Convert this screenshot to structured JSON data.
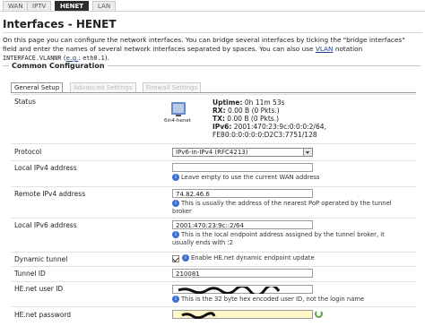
{
  "topTabs": [
    "WAN",
    "IPTV",
    "HENET",
    "LAN"
  ],
  "activeTopTab": "HENET",
  "title": "Interfaces - HENET",
  "intro": {
    "line1": "On this page you can configure the network interfaces. You can bridge several interfaces by ticking the \"bridge interfaces\"",
    "line2": "field and enter the names of several network interfaces separated by spaces. You can also use",
    "vlan": "VLAN",
    "line2b": "notation",
    "line3_code": "INTERFACE.VLANNR",
    "line3_eg": "e.g.",
    "line3_example": "eth0.1"
  },
  "legend": "Common Configuration",
  "subTabs": [
    "General Setup",
    "Advanced Settings",
    "Firewall Settings"
  ],
  "activeSubTab": "General Setup",
  "status": {
    "label": "Status",
    "iface": "6in4-henet",
    "uptime_key": "Uptime:",
    "uptime": "0h 11m 53s",
    "rx_key": "RX:",
    "rx": "0.00 B (0 Pkts.)",
    "tx_key": "TX:",
    "tx": "0.00 B (0 Pkts.)",
    "ipv6_key": "IPv6:",
    "ipv6_1": "2001:470:23:9c:0:0:0:2/64,",
    "ipv6_2": "FE80:0:0:0:0:0:D2C3:7751/128"
  },
  "protocol": {
    "label": "Protocol",
    "value": "IPv6-in-IPv4 (RFC4213)"
  },
  "localIPv4": {
    "label": "Local IPv4 address",
    "hint": "Leave empty to use the current WAN address"
  },
  "remoteIPv4": {
    "label": "Remote IPv4 address",
    "value": "74.82.46.6",
    "hint1": "This is usually the address of the nearest PoP operated by the tunnel",
    "hint2": "broker"
  },
  "localIPv6": {
    "label": "Local IPv6 address",
    "value": "2001:470:23:9c::2/64",
    "hint1": "This is the local endpoint address assigned by the tunnel broker, it",
    "hint2": "usually ends with",
    "hint2_code": ":2"
  },
  "dynamicTunnel": {
    "label": "Dynamic tunnel",
    "hint": "Enable HE.net dynamic endpoint update"
  },
  "tunnelId": {
    "label": "Tunnel ID",
    "value": "210081"
  },
  "userId": {
    "label": "HE.net user ID",
    "hint": "This is the 32 byte hex encoded user ID, not the login name"
  },
  "password": {
    "label": "HE.net password"
  },
  "colors": {
    "activeTab": "#2d2d2d",
    "link": "#224488",
    "info": "#3b6fd2"
  }
}
